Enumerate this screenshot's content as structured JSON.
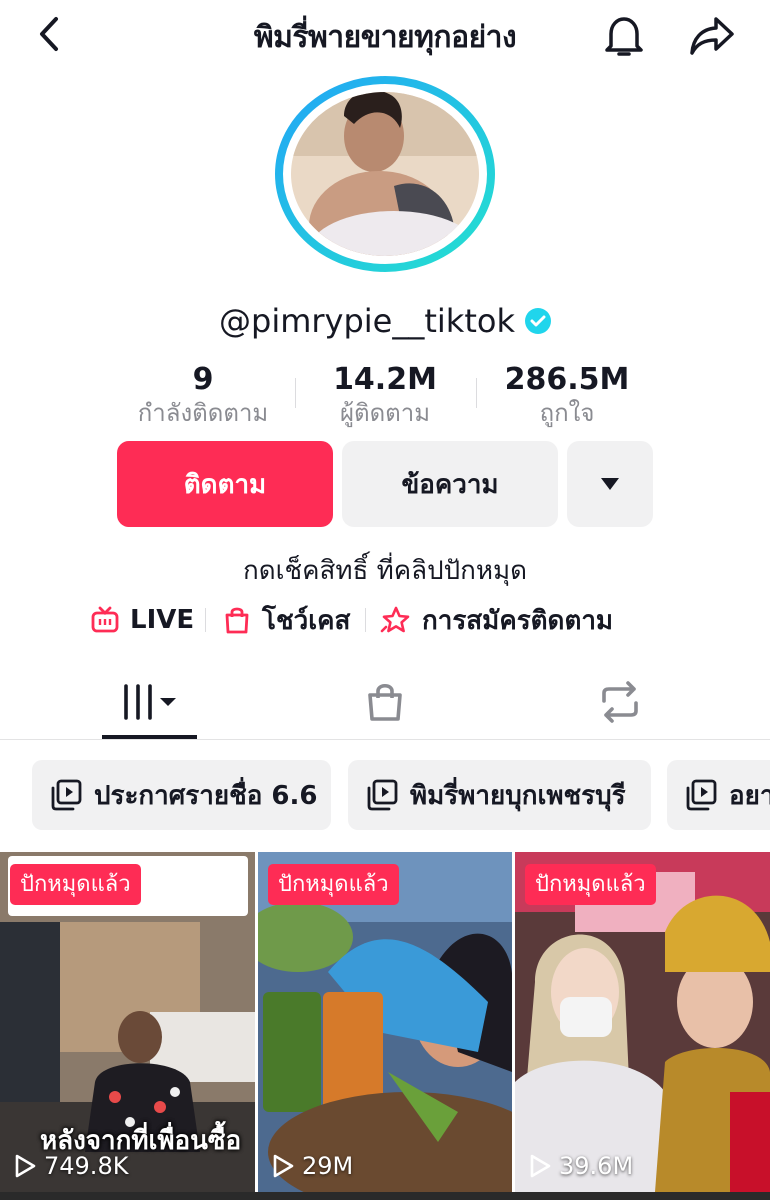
{
  "header": {
    "title": "พิมรี่พายขายทุกอย่าง"
  },
  "profile": {
    "username": "@pimrypie__tiktok",
    "verified": true
  },
  "stats": [
    {
      "value": "9",
      "label": "กำลังติดตาม"
    },
    {
      "value": "14.2M",
      "label": "ผู้ติดตาม"
    },
    {
      "value": "286.5M",
      "label": "ถูกใจ"
    }
  ],
  "actions": {
    "follow_label": "ติดตาม",
    "message_label": "ข้อความ"
  },
  "bio": "กดเช็คสิทธิ์ ที่คลิปปักหมุด",
  "links": [
    {
      "label": "LIVE",
      "icon": "tv-live-icon"
    },
    {
      "label": "โชว์เคส",
      "icon": "shopping-bag-icon"
    },
    {
      "label": "การสมัครติดตาม",
      "icon": "star-subscription-icon"
    }
  ],
  "tabs": [
    {
      "name": "videos",
      "icon": "grid-icon"
    },
    {
      "name": "shop",
      "icon": "shopping-bag-icon"
    },
    {
      "name": "reposts",
      "icon": "repost-icon"
    }
  ],
  "playlists": [
    {
      "label": "ประกาศรายชื่อ 6.6"
    },
    {
      "label": "พิมรี่พายบุกเพชรบุรี"
    },
    {
      "label": "อยา"
    }
  ],
  "videos": [
    {
      "pinned_label": "ปักหมุดแล้ว",
      "views": "749.8K",
      "caption": "หลังจากที่เพื่อนซื้อ"
    },
    {
      "pinned_label": "ปักหมุดแล้ว",
      "views": "29M"
    },
    {
      "pinned_label": "ปักหมุดแล้ว",
      "views": "39.6M"
    }
  ],
  "colors": {
    "accent": "#fe2c55",
    "verified": "#20d5ec",
    "secondary_text": "#8a8b91",
    "button_bg": "#f1f1f2"
  }
}
